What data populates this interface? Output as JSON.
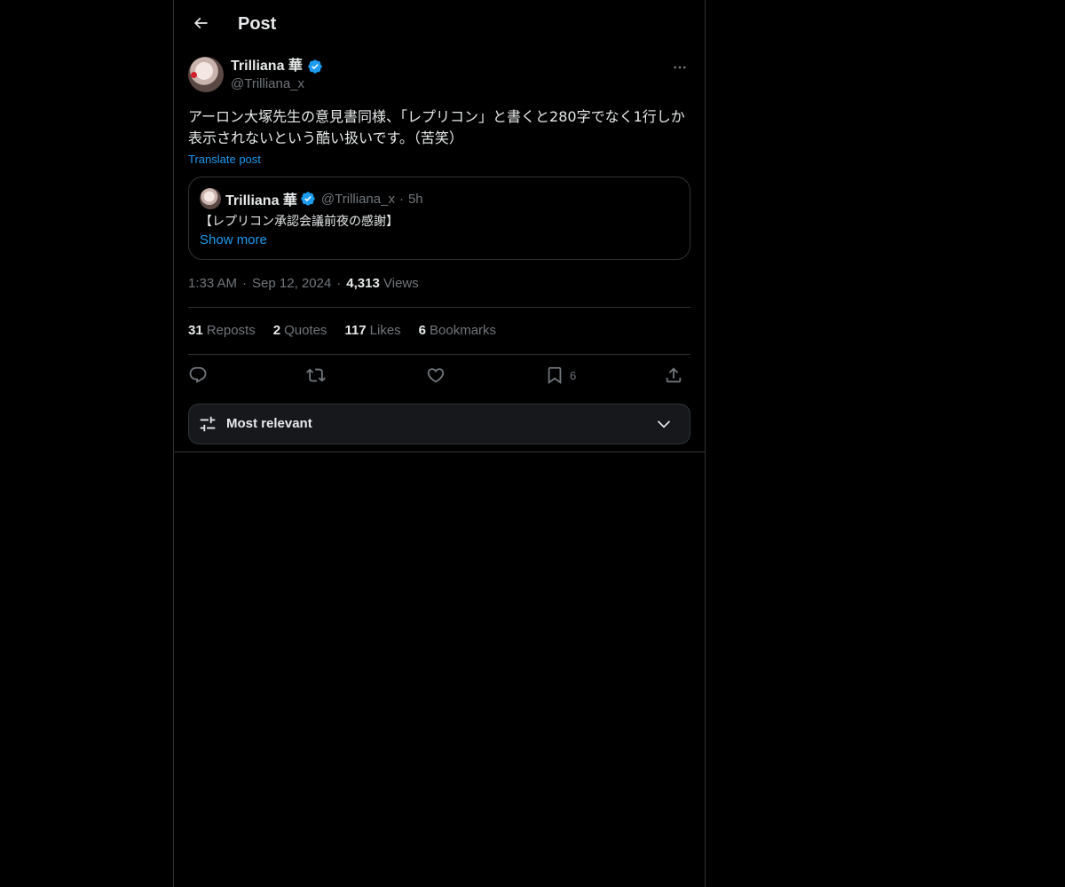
{
  "header": {
    "title": "Post"
  },
  "post": {
    "author_name": "Trilliana 華",
    "author_handle": "@Trilliana_x",
    "text": "アーロン大塚先生の意見書同様、「レプリコン」と書くと280字でなく1行しか表示されないという酷い扱いです。（苦笑）",
    "translate_label": "Translate post",
    "timestamp_time": "1:33 AM",
    "timestamp_date": "Sep 12, 2024",
    "views_count": "4,313",
    "views_label": "Views"
  },
  "quote": {
    "author_name": "Trilliana 華",
    "author_handle": "@Trilliana_x",
    "separator": "·",
    "time": "5h",
    "text": "【レプリコン承認会議前夜の感謝】",
    "show_more_label": "Show more"
  },
  "stats": {
    "reposts_count": "31",
    "reposts_label": "Reposts",
    "quotes_count": "2",
    "quotes_label": "Quotes",
    "likes_count": "117",
    "likes_label": "Likes",
    "bookmarks_count": "6",
    "bookmarks_label": "Bookmarks"
  },
  "actions": {
    "reply_icon": "reply-icon",
    "repost_icon": "repost-icon",
    "like_icon": "heart-icon",
    "bookmark_icon": "bookmark-icon",
    "bookmark_count": "6",
    "share_icon": "share-icon"
  },
  "sort": {
    "label": "Most relevant"
  },
  "colors": {
    "background": "#000000",
    "text_primary": "#e7e9ea",
    "text_secondary": "#71767b",
    "accent": "#1d9bf0",
    "border": "#2f3336"
  }
}
